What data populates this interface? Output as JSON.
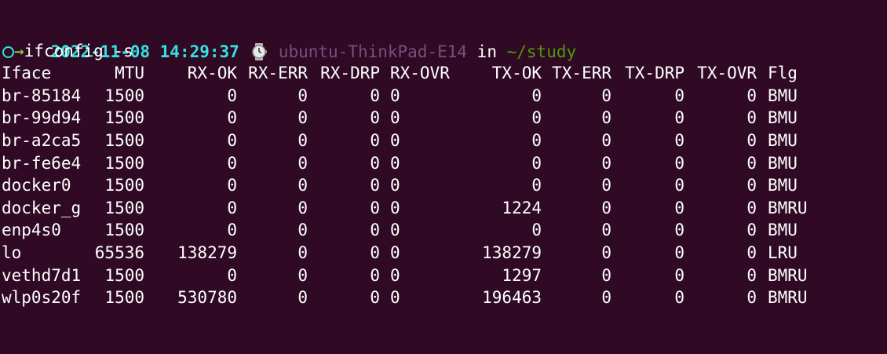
{
  "prompt": {
    "datetime": "2022-11-08 14:29:37",
    "host": "ubuntu-ThinkPad-E14",
    "in_word": "in",
    "path": "~/study",
    "arrow": "→",
    "command": "ifconfig -s"
  },
  "table": {
    "headers": [
      "Iface",
      "MTU",
      "RX-OK",
      "RX-ERR",
      "RX-DRP",
      "RX-OVR",
      "TX-OK",
      "TX-ERR",
      "TX-DRP",
      "TX-OVR",
      "Flg"
    ],
    "rows": [
      [
        "br-85184",
        "1500",
        "0",
        "0",
        "0",
        "0",
        "0",
        "0",
        "0",
        "0",
        "BMU"
      ],
      [
        "br-99d94",
        "1500",
        "0",
        "0",
        "0",
        "0",
        "0",
        "0",
        "0",
        "0",
        "BMU"
      ],
      [
        "br-a2ca5",
        "1500",
        "0",
        "0",
        "0",
        "0",
        "0",
        "0",
        "0",
        "0",
        "BMU"
      ],
      [
        "br-fe6e4",
        "1500",
        "0",
        "0",
        "0",
        "0",
        "0",
        "0",
        "0",
        "0",
        "BMU"
      ],
      [
        "docker0",
        "1500",
        "0",
        "0",
        "0",
        "0",
        "0",
        "0",
        "0",
        "0",
        "BMU"
      ],
      [
        "docker_g",
        "1500",
        "0",
        "0",
        "0",
        "0",
        "1224",
        "0",
        "0",
        "0",
        "BMRU"
      ],
      [
        "enp4s0",
        "1500",
        "0",
        "0",
        "0",
        "0",
        "0",
        "0",
        "0",
        "0",
        "BMU"
      ],
      [
        "lo",
        "65536",
        "138279",
        "0",
        "0",
        "0",
        "138279",
        "0",
        "0",
        "0",
        "LRU"
      ],
      [
        "vethd7d1",
        "1500",
        "0",
        "0",
        "0",
        "0",
        "1297",
        "0",
        "0",
        "0",
        "BMRU"
      ],
      [
        "wlp0s20f",
        "1500",
        "530780",
        "0",
        "0",
        "0",
        "196463",
        "0",
        "0",
        "0",
        "BMRU"
      ]
    ]
  },
  "icons": {
    "watch": "watch-icon",
    "prompt_circle": "circle-icon"
  },
  "colors": {
    "background": "#300a24",
    "date": "#34e2e2",
    "host": "#75507b",
    "path": "#4e9a06",
    "arrow": "#8ae234",
    "text": "#ffffff"
  }
}
